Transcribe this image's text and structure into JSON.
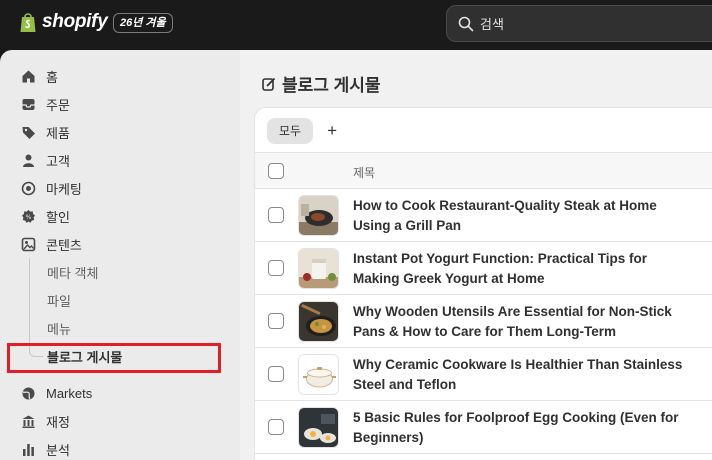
{
  "topbar": {
    "brand": "shopify",
    "edition": "26년 겨울",
    "search_placeholder": "검색"
  },
  "sidebar": {
    "items": [
      {
        "label": "홈",
        "icon": "home-icon"
      },
      {
        "label": "주문",
        "icon": "inbox-icon"
      },
      {
        "label": "제품",
        "icon": "tag-icon"
      },
      {
        "label": "고객",
        "icon": "person-icon"
      },
      {
        "label": "마케팅",
        "icon": "target-icon"
      },
      {
        "label": "할인",
        "icon": "discount-icon"
      },
      {
        "label": "콘텐츠",
        "icon": "content-icon"
      }
    ],
    "content_sub": [
      {
        "label": "메타 객체"
      },
      {
        "label": "파일"
      },
      {
        "label": "메뉴"
      },
      {
        "label": "블로그 게시물"
      }
    ],
    "bottom_items": [
      {
        "label": "Markets",
        "icon": "globe-icon"
      },
      {
        "label": "재정",
        "icon": "bank-icon"
      },
      {
        "label": "분석",
        "icon": "bar-chart-icon"
      }
    ]
  },
  "main": {
    "title": "블로그 게시물",
    "tabs": {
      "all": "모두",
      "add": "+"
    },
    "column_title": "제목",
    "posts": [
      {
        "title": "How to Cook Restaurant-Quality Steak at Home Using a Grill Pan"
      },
      {
        "title": "Instant Pot Yogurt Function: Practical Tips for Making Greek Yogurt at Home"
      },
      {
        "title": "Why Wooden Utensils Are Essential for Non-Stick Pans & How to Care for Them Long-Term"
      },
      {
        "title": "Why Ceramic Cookware Is Healthier Than Stainless Steel and Teflon"
      },
      {
        "title": "5 Basic Rules for Foolproof Egg Cooking (Even for Beginners)"
      }
    ]
  },
  "colors": {
    "topbar": "#1a1a1a",
    "sidebar": "#ebebeb",
    "highlight": "#e01f26",
    "brand_green": "#95bf47"
  }
}
